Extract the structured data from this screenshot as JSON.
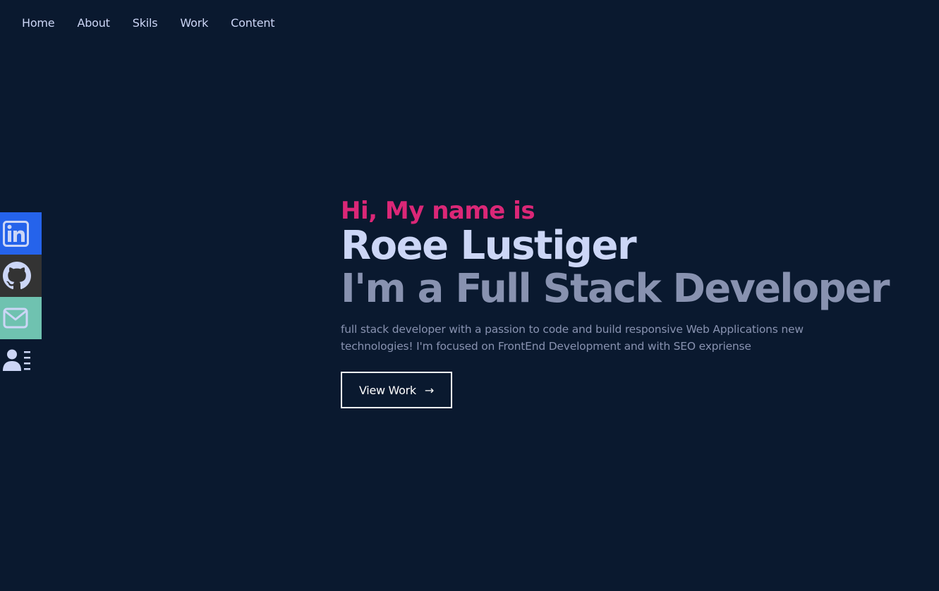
{
  "nav": {
    "items": [
      {
        "label": "Home"
      },
      {
        "label": "About"
      },
      {
        "label": "Skils"
      },
      {
        "label": "Work"
      },
      {
        "label": "Content"
      }
    ]
  },
  "social": {
    "items": [
      {
        "icon": "linkedin-icon",
        "color": "#2563eb"
      },
      {
        "icon": "github-icon",
        "color": "#333333"
      },
      {
        "icon": "mail-icon",
        "color": "#6fc2b0"
      },
      {
        "icon": "resume-icon",
        "color": "transparent"
      }
    ]
  },
  "hero": {
    "greeting": "Hi, My name is",
    "name": "Roee Lustiger",
    "role": "I'm a Full Stack Developer",
    "description": "full stack developer with a passion to code and build responsive Web Applications new technologies! I'm focused on FrontEnd Development and with SEO expriense",
    "button_label": "View Work",
    "button_arrow": "→"
  },
  "colors": {
    "background": "#0a192f",
    "accent": "#db2777",
    "heading": "#ccd6f6",
    "muted": "#8892b0"
  }
}
